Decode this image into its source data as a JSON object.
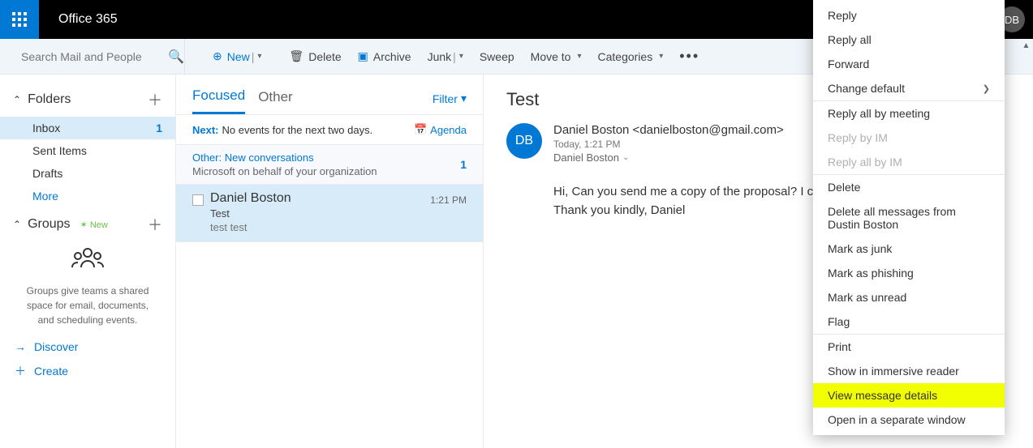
{
  "brand": "Office 365",
  "avatar": "DB",
  "search": {
    "placeholder": "Search Mail and People"
  },
  "toolbar": {
    "new": "New",
    "delete": "Delete",
    "archive": "Archive",
    "junk": "Junk",
    "sweep": "Sweep",
    "moveto": "Move to",
    "categories": "Categories"
  },
  "sidebar": {
    "folders_label": "Folders",
    "items": [
      {
        "label": "Inbox",
        "count": "1",
        "selected": true
      },
      {
        "label": "Sent Items"
      },
      {
        "label": "Drafts"
      },
      {
        "label": "More",
        "more": true
      }
    ],
    "groups_label": "Groups",
    "new_badge": "New",
    "groups_blurb": "Groups give teams a shared space for email, documents, and scheduling events.",
    "discover": "Discover",
    "create": "Create"
  },
  "list": {
    "tab_focused": "Focused",
    "tab_other": "Other",
    "filter": "Filter",
    "next_label": "Next:",
    "next_text": "No events for the next two days.",
    "agenda": "Agenda",
    "other_title": "Other: New conversations",
    "other_sub": "Microsoft on behalf of your organization",
    "other_count": "1",
    "message": {
      "from": "Daniel Boston",
      "subject": "Test",
      "preview": "test test",
      "time": "1:21 PM"
    }
  },
  "reading": {
    "title": "Test",
    "avatar": "DB",
    "sender": "Daniel Boston <danielboston@gmail.com>",
    "date": "Today, 1:21 PM",
    "to": "Daniel Boston",
    "body_line1": "Hi, Can you send me a copy of the proposal? I c",
    "body_line2": "Thank you kindly, Daniel"
  },
  "context_menu": [
    {
      "label": "Reply"
    },
    {
      "label": "Reply all"
    },
    {
      "label": "Forward"
    },
    {
      "label": "Change default",
      "submenu": true
    },
    {
      "label": "Reply all by meeting",
      "sep": true
    },
    {
      "label": "Reply by IM",
      "disabled": true
    },
    {
      "label": "Reply all by IM",
      "disabled": true
    },
    {
      "label": "Delete",
      "sep": true
    },
    {
      "label": "Delete all messages from Dustin Boston"
    },
    {
      "label": "Mark as junk"
    },
    {
      "label": "Mark as phishing"
    },
    {
      "label": "Mark as unread"
    },
    {
      "label": "Flag"
    },
    {
      "label": "Print",
      "sep": true
    },
    {
      "label": "Show in immersive reader"
    },
    {
      "label": "View message details",
      "highlight": true
    },
    {
      "label": "Open in a separate window"
    }
  ]
}
